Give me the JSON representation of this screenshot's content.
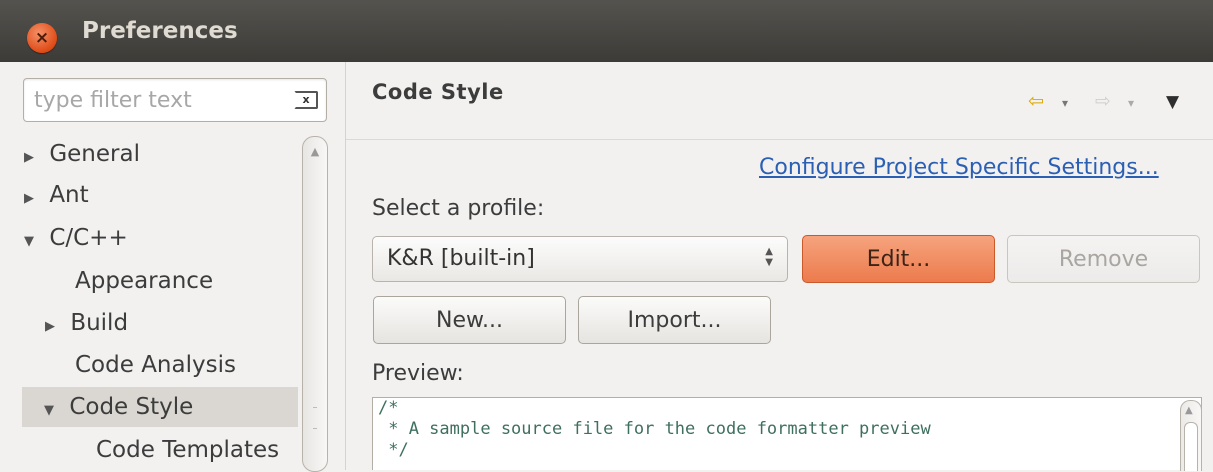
{
  "window": {
    "title": "Preferences",
    "close_glyph": "×"
  },
  "filter": {
    "placeholder": "type filter text",
    "value": "",
    "clear_glyph": "x"
  },
  "tree": {
    "items": [
      {
        "label": "General",
        "arrow": "▶"
      },
      {
        "label": "Ant",
        "arrow": "▶"
      },
      {
        "label": "C/C++",
        "arrow": "▼"
      },
      {
        "label": "Appearance",
        "arrow": ""
      },
      {
        "label": "Build",
        "arrow": "▶"
      },
      {
        "label": "Code Analysis",
        "arrow": ""
      },
      {
        "label": "Code Style",
        "arrow": "▼"
      },
      {
        "label": "Code Templates",
        "arrow": ""
      }
    ],
    "selected": "Code Style"
  },
  "page": {
    "title": "Code Style",
    "nav": {
      "back": "⇦",
      "forward": "⇨",
      "dropdown": "▾",
      "menu": "▼"
    },
    "project_link": "Configure Project Specific Settings...",
    "profile_label": "Select a profile:",
    "profile_selected": "K&R [built-in]",
    "buttons": {
      "edit": "Edit...",
      "remove": "Remove",
      "new": "New...",
      "import": "Import..."
    },
    "preview_label": "Preview:",
    "preview_code": "/*\n * A sample source file for the code formatter preview\n */"
  },
  "icons": [
    "close-icon",
    "clear-icon",
    "back-arrow-icon",
    "forward-arrow-icon",
    "dropdown-icon",
    "menu-icon",
    "expand-arrow-icon"
  ],
  "colors": {
    "titlebar": "#3c3b37",
    "close": "#df4b16",
    "edit_button": "#ec7b4d",
    "link": "#2b5fb4"
  }
}
